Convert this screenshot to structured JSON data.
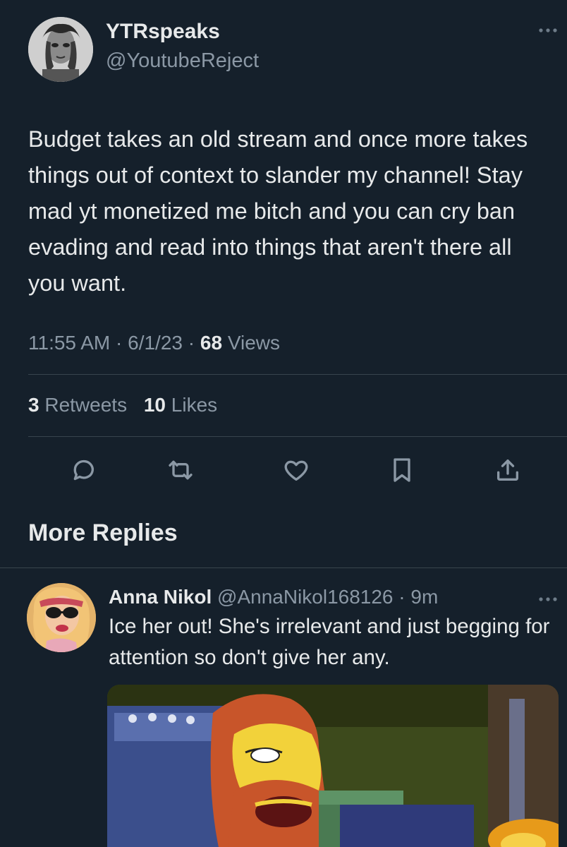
{
  "main_tweet": {
    "display_name": "YTRspeaks",
    "handle": "@YoutubeReject",
    "more_icon": "ellipsis-icon",
    "text": "Budget takes an old stream and once more takes things out of context to slander my channel! Stay mad yt monetized me bitch and you can cry ban evading and read into things that aren't there all you want.",
    "time": "11:55 AM",
    "date": "6/1/23",
    "views_count": "68",
    "views_label": "Views",
    "retweets_count": "3",
    "retweets_label": "Retweets",
    "likes_count": "10",
    "likes_label": "Likes"
  },
  "actions": [
    {
      "name": "reply-icon"
    },
    {
      "name": "retweet-icon"
    },
    {
      "name": "like-icon"
    },
    {
      "name": "bookmark-icon"
    },
    {
      "name": "share-icon"
    }
  ],
  "section_title": "More Replies",
  "reply": {
    "display_name": "Anna Nikol",
    "handle": "@AnnaNikol168126",
    "time": "9m",
    "text": "Ice her out! She's irrelevant and just begging for attention so don't give her any."
  },
  "colors": {
    "background": "#15202b",
    "text": "#e7e9ea",
    "secondary": "#8b98a5",
    "divider": "#38444d"
  }
}
